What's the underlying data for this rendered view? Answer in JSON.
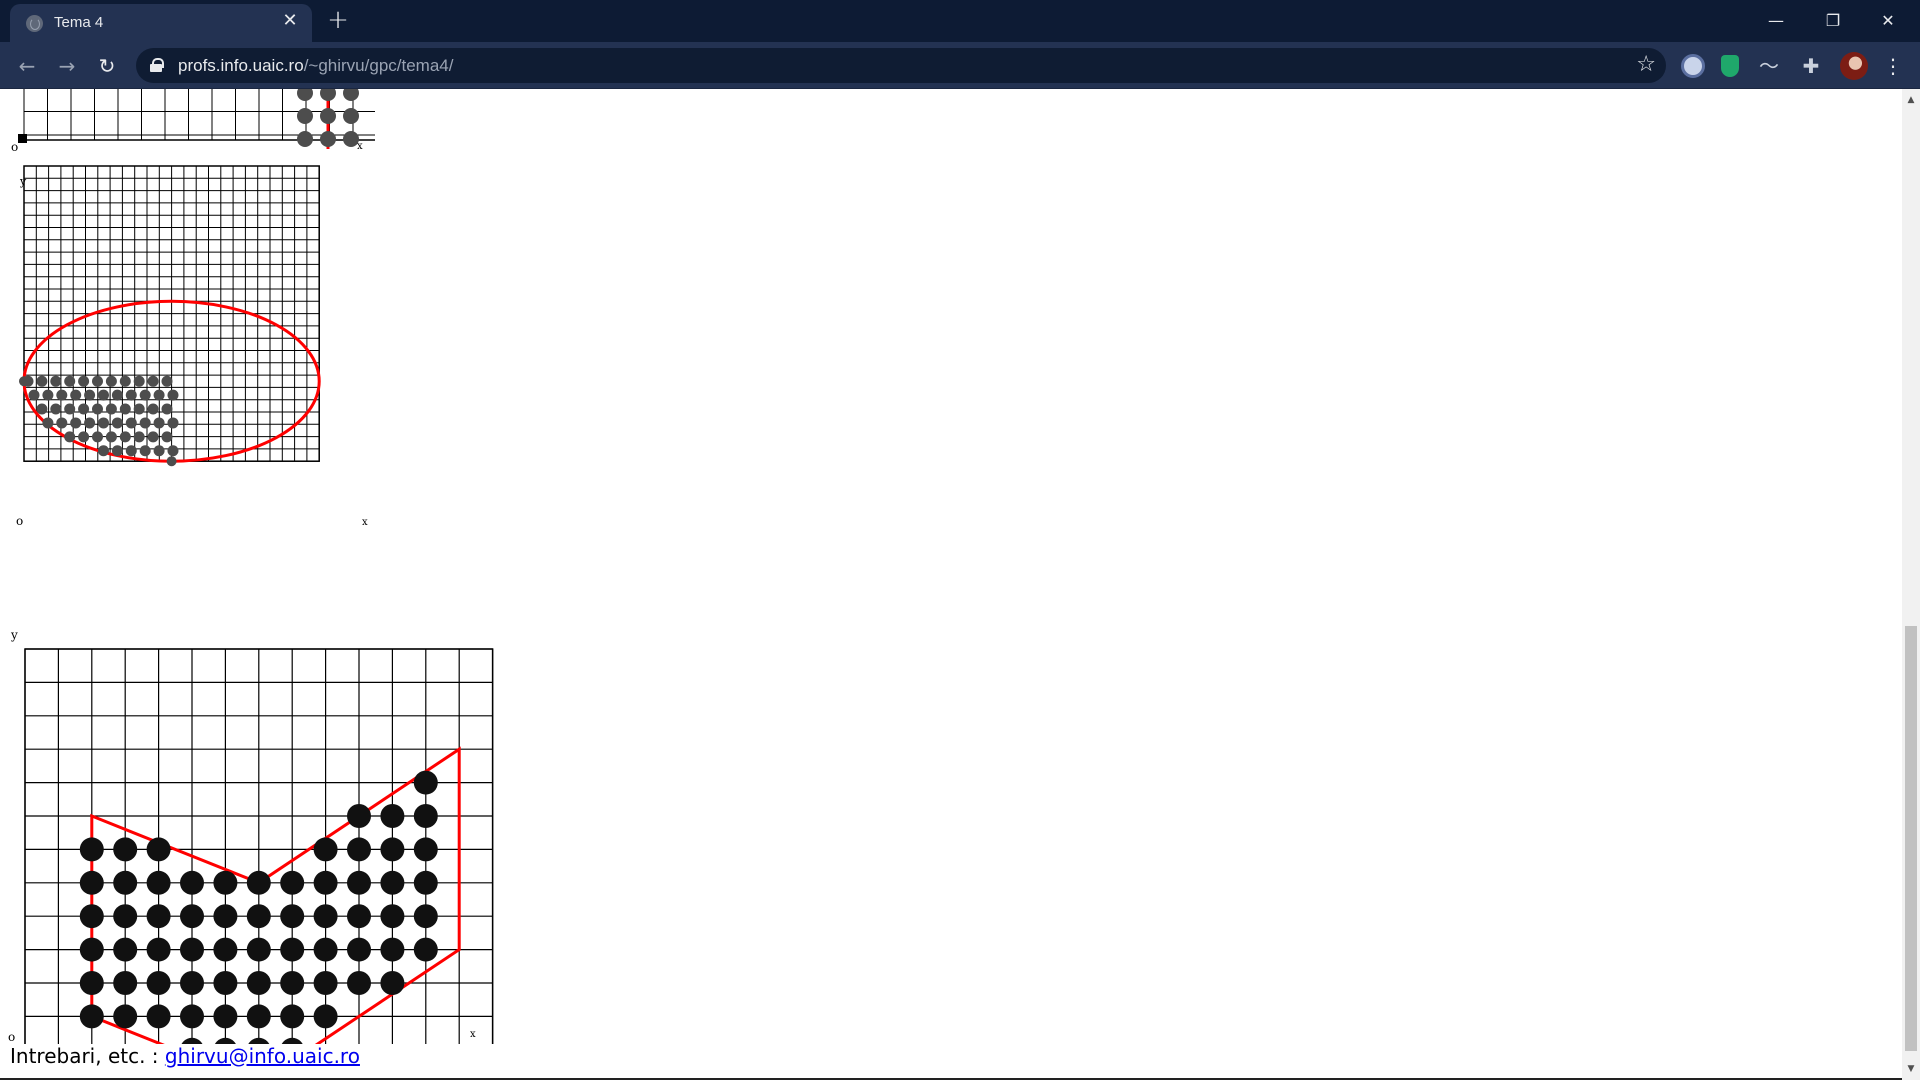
{
  "browser": {
    "tab_title": "Tema 4",
    "url_host": "profs.info.uaic.ro",
    "url_path": "/~ghirvu/gpc/tema4/",
    "icons": [
      "globe-icon",
      "close-icon",
      "plus-icon",
      "back-icon",
      "forward-icon",
      "reload-icon",
      "lock-icon",
      "star-icon",
      "puzzle-icon",
      "kebab-menu-icon"
    ]
  },
  "page": {
    "footer_text": "Intrebari, etc. : ",
    "footer_link": "ghirvu@info.uaic.ro",
    "fig1_labels": {
      "origin": "o",
      "x": "x"
    },
    "fig2_labels": {
      "origin": "o",
      "x": "x",
      "y": "y"
    },
    "fig3_labels": {
      "origin": "o",
      "x": "x",
      "y": "y"
    }
  },
  "colors": {
    "outline": "#ff0000",
    "grid": "#000000",
    "pixel_small": "#4d4d4d",
    "pixel_large": "#000000",
    "tabbar": "#0d1b34",
    "toolbar": "#233252"
  }
}
